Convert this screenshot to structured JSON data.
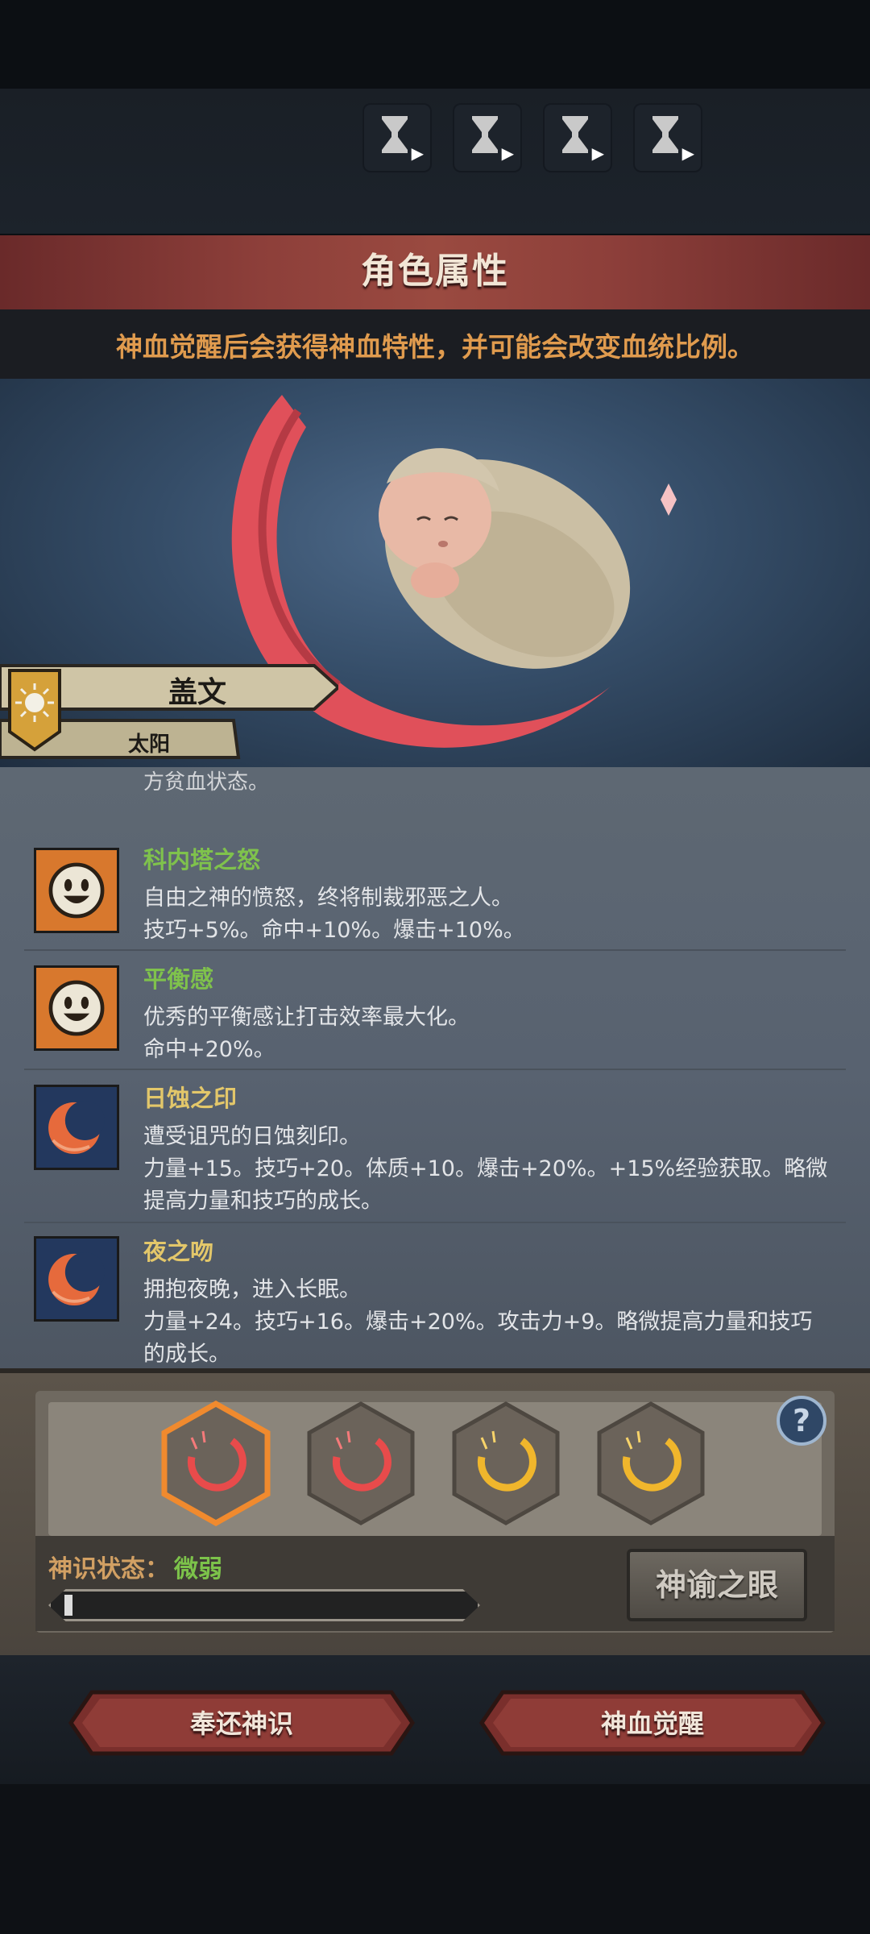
{
  "timers": [
    {
      "icon": "hourglass-play-icon"
    },
    {
      "icon": "hourglass-play-icon"
    },
    {
      "icon": "hourglass-play-icon"
    },
    {
      "icon": "hourglass-play-icon"
    }
  ],
  "header": {
    "title": "角色属性",
    "hint": "神血觉醒后会获得神血特性，并可能会改变血统比例。"
  },
  "character": {
    "name": "盖文",
    "subtitle": "太阳",
    "emblem_icon": "sun-emblem-icon"
  },
  "traits_cut_line": "方贫血状态。",
  "traits": [
    {
      "name": "科内塔之怒",
      "name_color": "#7fc24c",
      "icon": "smiley-face-icon",
      "lines": [
        "自由之神的愤怒，终将制裁邪恶之人。",
        "技巧+5%。命中+10%。爆击+10%。"
      ]
    },
    {
      "name": "平衡感",
      "name_color": "#7fc24c",
      "icon": "smiley-face-icon",
      "lines": [
        "优秀的平衡感让打击效率最大化。",
        "命中+20%。"
      ]
    },
    {
      "name": "日蚀之印",
      "name_color": "#e3c76a",
      "icon": "crescent-moon-icon",
      "lines": [
        "遭受诅咒的日蚀刻印。",
        "力量+15。技巧+20。体质+10。爆击+20%。+15%经验获取。略微",
        "提高力量和技巧的成长。"
      ]
    },
    {
      "name": "夜之吻",
      "name_color": "#e3c76a",
      "icon": "crescent-moon-icon",
      "lines": [
        "拥抱夜晚，进入长眠。",
        "力量+24。技巧+16。爆击+20%。攻击力+9。略微提高力量和技巧",
        "的成长。"
      ]
    }
  ],
  "slots": [
    {
      "icon": "red-crescent-icon",
      "selected": true
    },
    {
      "icon": "red-crescent-icon",
      "selected": false
    },
    {
      "icon": "gold-crescent-icon",
      "selected": false
    },
    {
      "icon": "gold-crescent-icon",
      "selected": false
    }
  ],
  "panel": {
    "help": "?",
    "status_label": "神识状态：",
    "status_value": "微弱",
    "progress": 0.02,
    "eye_button": "神谕之眼"
  },
  "actions": {
    "return": "奉还神识",
    "awaken": "神血觉醒"
  },
  "colors": {
    "accent_red": "#8d3f3a",
    "hint_orange": "#e09b4e",
    "status_green": "#7cc24a"
  }
}
